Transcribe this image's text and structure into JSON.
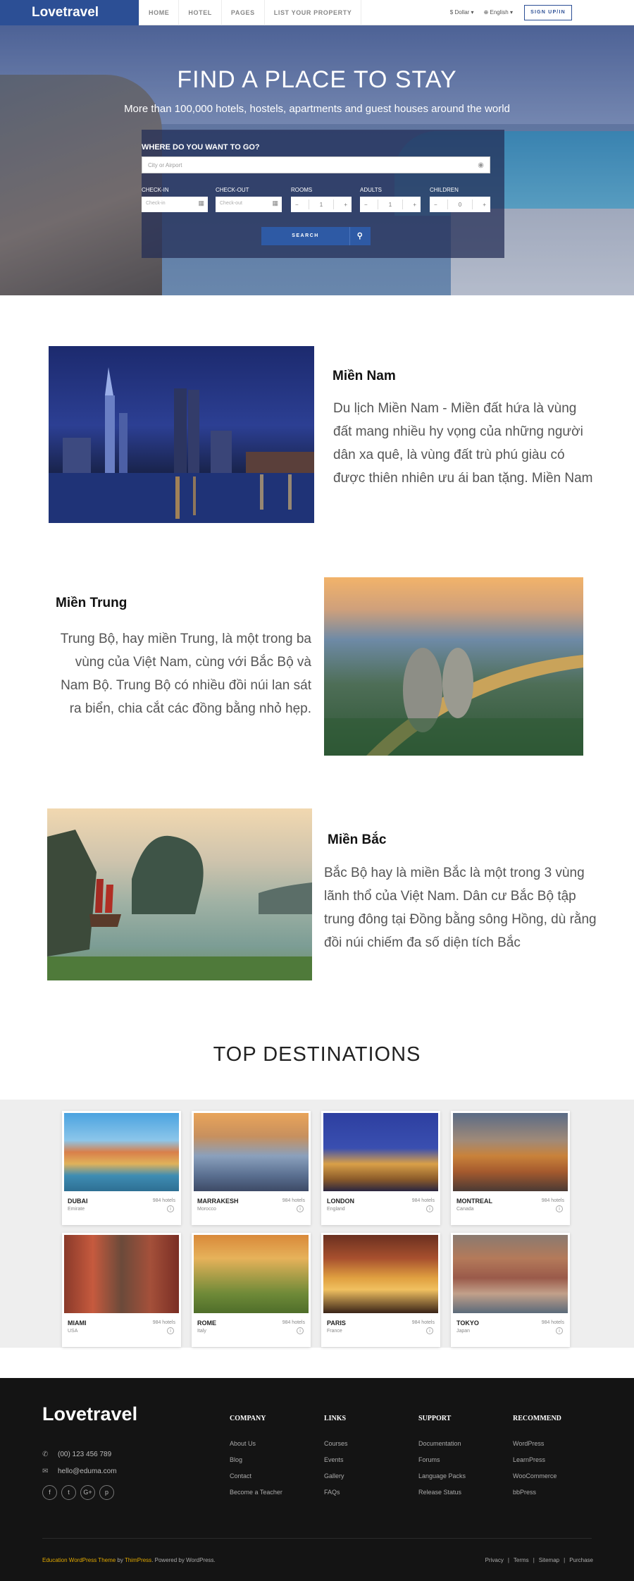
{
  "header": {
    "logo": "Lovetravel",
    "nav": [
      "HOME",
      "HOTEL",
      "PAGES",
      "LIST YOUR PROPERTY"
    ],
    "currency": "$ Dollar ▾",
    "language": "English ▾",
    "signup": "SIGN UP/IN"
  },
  "hero": {
    "title": "FIND A PLACE TO STAY",
    "subtitle": "More than 100,000 hotels, hostels, apartments and guest houses around the world",
    "search_label": "WHERE DO YOU WANT TO GO?",
    "search_placeholder": "City or Airport",
    "checkin_label": "CHECK-IN",
    "checkin_placeholder": "Check-in",
    "checkout_label": "CHECK-OUT",
    "checkout_placeholder": "Check-out",
    "rooms_label": "ROOMS",
    "rooms_value": "1",
    "adults_label": "ADULTS",
    "adults_value": "1",
    "children_label": "CHILDREN",
    "children_value": "0",
    "search_button": "SEARCH"
  },
  "regions": {
    "south_title": "Miền Nam",
    "south_text": "Du lịch Miền Nam - Miền đất hứa là vùng đất mang nhiều hy vọng của những người dân xa quê, là vùng đất trù phú giàu có được thiên nhiên ưu ái ban tặng. Miền Nam",
    "central_title": "Miền Trung",
    "central_text": "Trung Bộ, hay miền Trung, là một trong ba vùng của Việt Nam, cùng với Bắc Bộ và Nam Bộ. Trung Bộ có nhiều đồi núi lan sát ra biển, chia cắt các đồng bằng nhỏ hẹp.",
    "north_title": "Miền Bắc",
    "north_text": "Bắc Bộ hay là miền Bắc là một trong 3 vùng lãnh thổ của Việt Nam. Dân cư Bắc Bộ tập trung đông tại Đồng bằng sông Hồng, dù rằng đồi núi chiếm đa số diện tích Bắc"
  },
  "destinations": {
    "heading": "TOP DESTINATIONS",
    "cards": [
      {
        "city": "DUBAI",
        "country": "Emirate",
        "hotels": "984 hotels"
      },
      {
        "city": "MARRAKESH",
        "country": "Morocco",
        "hotels": "984 hotels"
      },
      {
        "city": "LONDON",
        "country": "England",
        "hotels": "984 hotels"
      },
      {
        "city": "MONTREAL",
        "country": "Canada",
        "hotels": "984 hotels"
      },
      {
        "city": "MIAMI",
        "country": "USA",
        "hotels": "984 hotels"
      },
      {
        "city": "ROME",
        "country": "Italy",
        "hotels": "984 hotels"
      },
      {
        "city": "PARIS",
        "country": "France",
        "hotels": "984 hotels"
      },
      {
        "city": "TOKYO",
        "country": "Japan",
        "hotels": "984 hotels"
      }
    ]
  },
  "footer": {
    "logo": "Lovetravel",
    "phone": "(00) 123 456 789",
    "email": "hello@eduma.com",
    "columns": [
      {
        "title": "COMPANY",
        "items": [
          "About Us",
          "Blog",
          "Contact",
          "Become a Teacher"
        ]
      },
      {
        "title": "LINKS",
        "items": [
          "Courses",
          "Events",
          "Gallery",
          "FAQs"
        ]
      },
      {
        "title": "SUPPORT",
        "items": [
          "Documentation",
          "Forums",
          "Language Packs",
          "Release Status"
        ]
      },
      {
        "title": "RECOMMEND",
        "items": [
          "WordPress",
          "LearnPress",
          "WooCommerce",
          "bbPress"
        ]
      }
    ],
    "credit_theme": "Education WordPress Theme",
    "credit_by": " by ",
    "credit_author": "ThimPress",
    "credit_powered": ". Powered by WordPress.",
    "bottom_links": [
      "Privacy",
      "Terms",
      "Sitemap",
      "Purchase"
    ]
  }
}
